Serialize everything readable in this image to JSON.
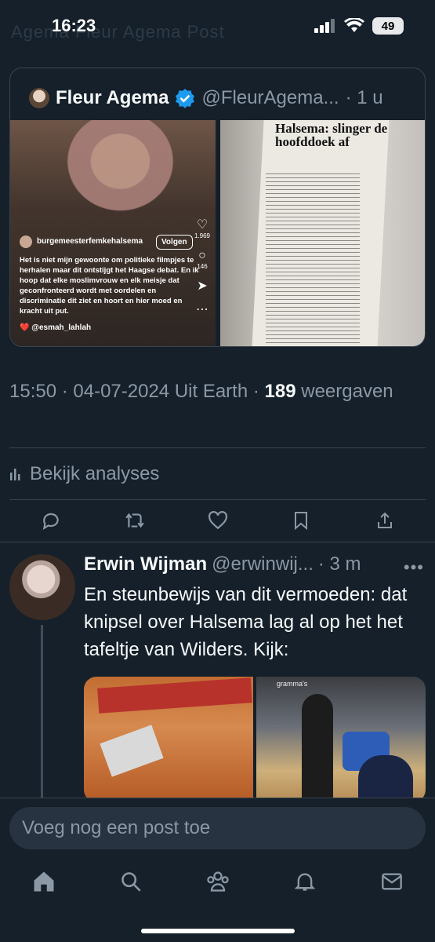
{
  "status_bar": {
    "time": "16:23",
    "battery": "49",
    "faded_header": "Agema Fleur Agema Post"
  },
  "quoted_tweet": {
    "name": "Fleur Agema",
    "handle": "@FleurAgema...",
    "time": "· 1 u",
    "instagram": {
      "username": "burgemeesterfemkehalsema",
      "follow_label": "Volgen",
      "caption": "Het is niet mijn gewoonte om politieke filmpjes te herhalen maar dit ontstijgt het Haagse debat. En ik hoop dat elke moslimvrouw en elk meisje dat geconfronteerd wordt met oordelen en discriminatie dit ziet en hoort en hier moed en kracht uit put.",
      "tag": "❤️ @esmah_lahlah",
      "likes": "1.969",
      "comments": "146"
    },
    "newspaper_headline": "Halsema: slinger de hoofddoek af"
  },
  "meta": {
    "timestamp": "15:50 · 04-07-2024 Uit Earth · ",
    "views_count": "189",
    "views_label": "weergaven"
  },
  "analytics_label": "Bekijk analyses",
  "reply": {
    "name": "Erwin Wijman",
    "handle": "@erwinwij...",
    "time": "· 3 m",
    "text": "En steunbewijs van dit vermoeden: dat knipsel over Halsema lag al op het het tafeltje van Wilders. Kijk:",
    "image_caption": "gramma's"
  },
  "compose": {
    "placeholder": "Voeg nog een post toe"
  },
  "colors": {
    "background": "#15202b",
    "accent": "#1d9bf0",
    "muted": "#8b98a5"
  },
  "icons": [
    "home-icon",
    "search-icon",
    "communities-icon",
    "notifications-icon",
    "messages-icon"
  ]
}
